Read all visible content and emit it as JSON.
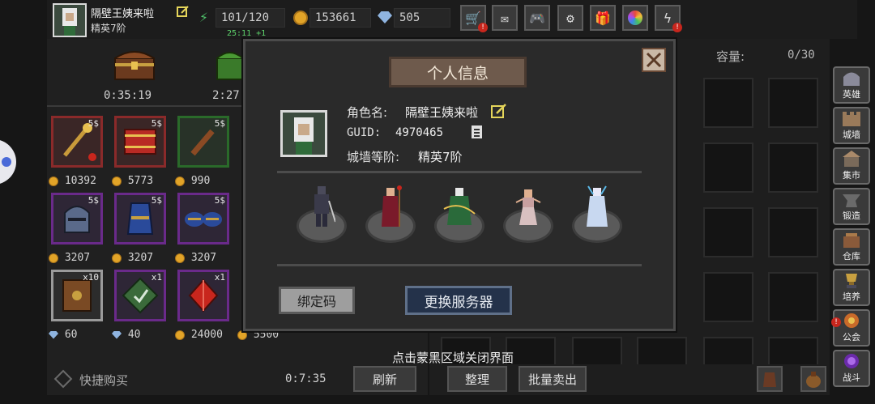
{
  "player": {
    "name": "隔壁王姨来啦",
    "rank": "精英7阶"
  },
  "resources": {
    "energy": "101/120",
    "energy_timer": "25:11 +1",
    "gold": "153661",
    "gems": "505"
  },
  "top_icons": [
    "shop-cart-icon",
    "mail-icon",
    "gamepad-icon",
    "gear-icon",
    "gift-icon",
    "color-wheel-icon",
    "lightning-icon"
  ],
  "chests": [
    {
      "timer": "0:35:19"
    },
    {
      "timer": "2:27"
    }
  ],
  "shop": {
    "rows": [
      [
        {
          "icon": "golden-staff-icon",
          "tag": "5$",
          "price": "10392",
          "currency": "gold",
          "rarity": "red"
        },
        {
          "icon": "red-tome-icon",
          "tag": "5$",
          "price": "5773",
          "currency": "gold",
          "rarity": "red"
        },
        {
          "icon": "wooden-club-icon",
          "tag": "5$",
          "price": "990",
          "currency": "gold",
          "rarity": "green"
        }
      ],
      [
        {
          "icon": "knight-helmet-icon",
          "tag": "5$",
          "price": "3207",
          "currency": "gold",
          "rarity": "purple"
        },
        {
          "icon": "blue-armor-icon",
          "tag": "5$",
          "price": "3207",
          "currency": "gold",
          "rarity": "purple"
        },
        {
          "icon": "blue-gauntlets-icon",
          "tag": "5$",
          "price": "3207",
          "currency": "gold",
          "rarity": "purple"
        }
      ],
      [
        {
          "icon": "spell-book-icon",
          "tag": "x10",
          "price": "60",
          "currency": "gem",
          "rarity": "gray"
        },
        {
          "icon": "green-rune-icon",
          "tag": "x1",
          "price": "40",
          "currency": "gem",
          "rarity": "purple"
        },
        {
          "icon": "red-crystal-icon",
          "tag": "x1",
          "price": "24000",
          "currency": "gold",
          "rarity": "purple"
        }
      ]
    ],
    "extra_price": "5500",
    "quick_buy": "快捷购买",
    "refresh_timer": "0:7:35",
    "refresh_label": "刷新"
  },
  "inventory": {
    "capacity_label": "容量:",
    "capacity_value": "0/30",
    "sort_label": "整理",
    "bulk_sell_label": "批量卖出"
  },
  "sidebar": [
    {
      "label": "英雄",
      "icon": "helmet-icon"
    },
    {
      "label": "城墙",
      "icon": "wall-icon"
    },
    {
      "label": "集市",
      "icon": "market-icon"
    },
    {
      "label": "锻造",
      "icon": "anvil-icon"
    },
    {
      "label": "仓库",
      "icon": "warehouse-icon"
    },
    {
      "label": "培养",
      "icon": "trophy-icon"
    },
    {
      "label": "公会",
      "icon": "guild-icon"
    },
    {
      "label": "战斗",
      "icon": "portal-icon"
    }
  ],
  "modal": {
    "title": "个人信息",
    "name_label": "角色名:",
    "name_value": "隔壁王姨来啦",
    "guid_label": "GUID:",
    "guid_value": "4970465",
    "wall_label": "城墙等阶:",
    "wall_value": "精英7阶",
    "heroes": [
      "armored-knight-icon",
      "red-mage-icon",
      "green-ranger-icon",
      "dancer-icon",
      "ice-sorceress-icon"
    ],
    "bind_code_label": "绑定码",
    "change_server_label": "更换服务器"
  },
  "overlay_hint": "点击蒙黑区域关闭界面"
}
